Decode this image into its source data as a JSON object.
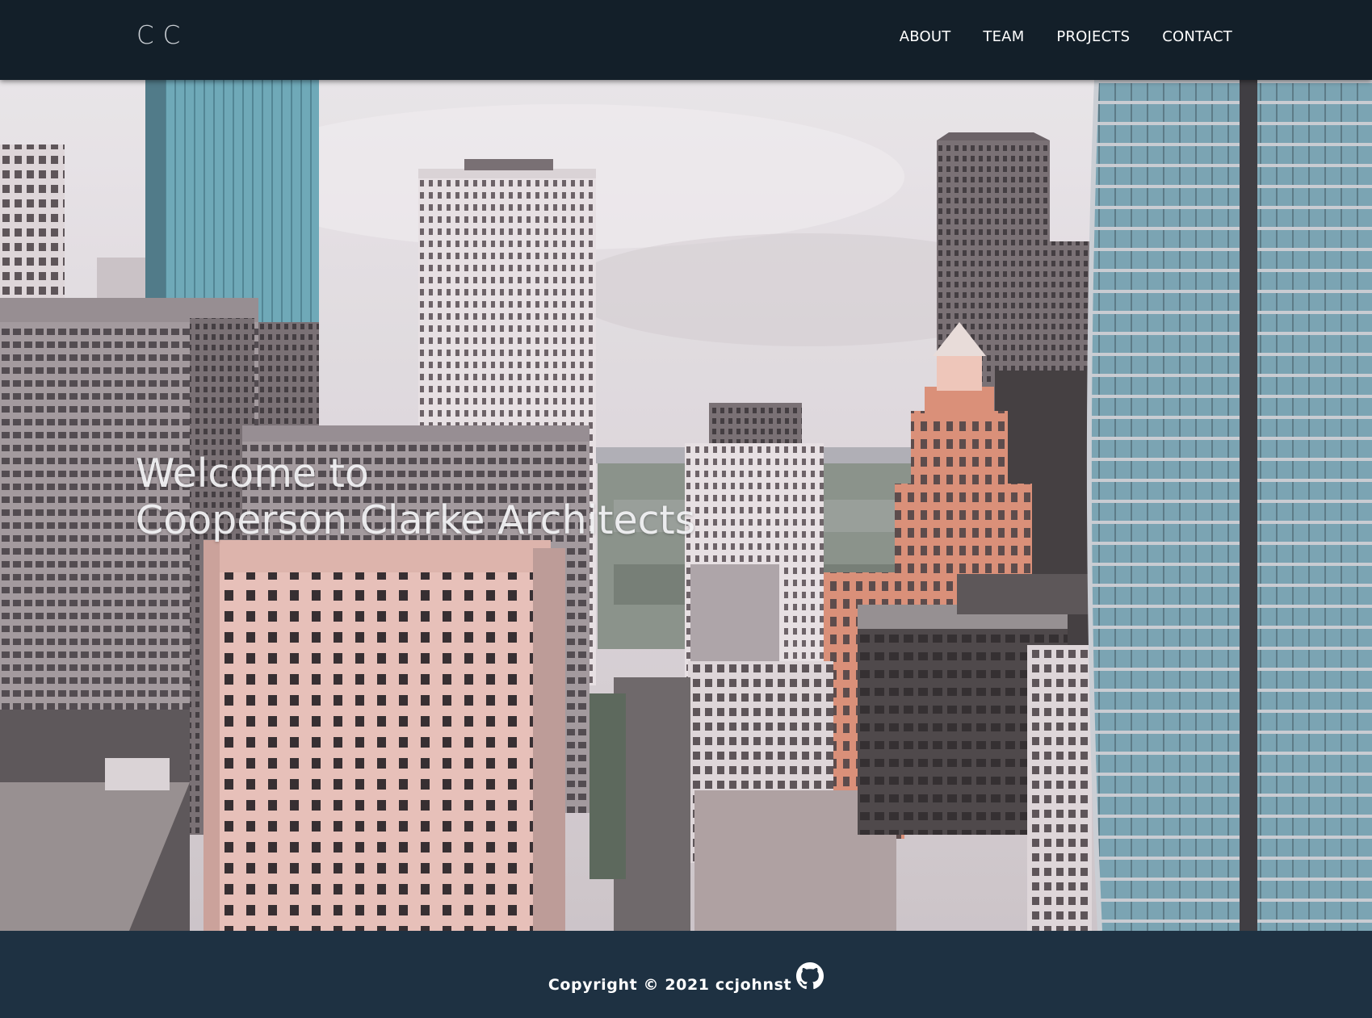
{
  "header": {
    "logo": "CC",
    "nav": [
      {
        "label": "ABOUT"
      },
      {
        "label": "TEAM"
      },
      {
        "label": "PROJECTS"
      },
      {
        "label": "CONTACT"
      }
    ]
  },
  "hero": {
    "title_line1": "Welcome to",
    "title_line2": "Cooperson Clarke Architects",
    "background": "aerial-city-skyline-video"
  },
  "footer": {
    "copyright": "Copyright © 2021 ccjohnst",
    "icon": "github-icon"
  },
  "colors": {
    "header_bg": "#131f29",
    "footer_bg": "#1e3142",
    "text": "#ffffff"
  }
}
